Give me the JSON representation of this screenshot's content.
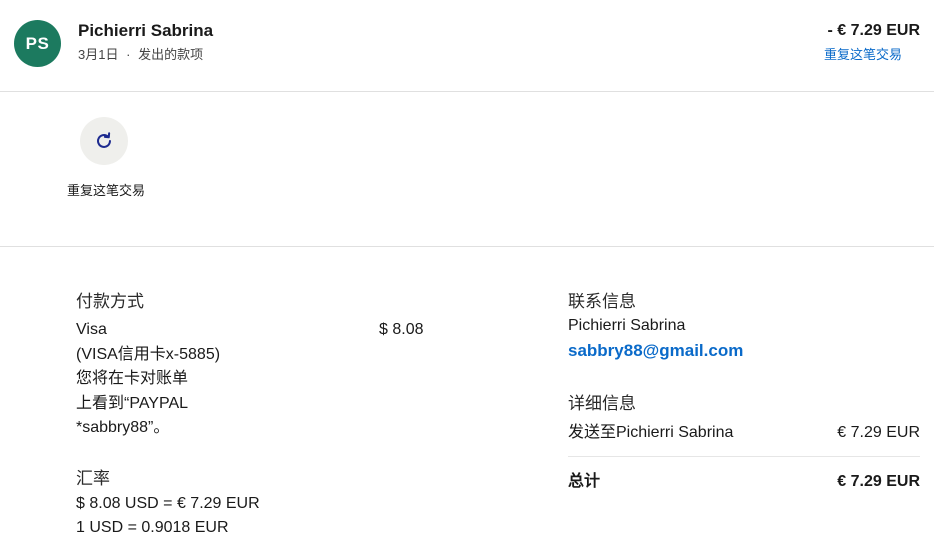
{
  "header": {
    "avatar_initials": "PS",
    "name": "Pichierri Sabrina",
    "date": "3月1日",
    "separator": "·",
    "type": "发出的款项",
    "amount": "- € 7.29 EUR",
    "repeat_link": "重复这笔交易"
  },
  "action": {
    "icon": "refresh-icon",
    "label": "重复这笔交易"
  },
  "payment": {
    "title": "付款方式",
    "method_lines": [
      "Visa",
      "(VISA信用卡x-5885)",
      "您将在卡对账单",
      "上看到“PAYPAL",
      "*sabbry88”。"
    ],
    "amount": "$ 8.08"
  },
  "exchange": {
    "title": "汇率",
    "line1": "$ 8.08 USD = € 7.29 EUR",
    "line2": "1 USD = 0.9018 EUR"
  },
  "contact": {
    "title": "联系信息",
    "name": "Pichierri Sabrina",
    "email": "sabbry88@gmail.com"
  },
  "details": {
    "title": "详细信息",
    "sent_to_label": "发送至Pichierri Sabrina",
    "sent_to_amount": "€ 7.29 EUR",
    "total_label": "总计",
    "total_amount": "€ 7.29 EUR"
  },
  "colors": {
    "avatar": "#1c7a5f",
    "link": "#0a6ac9",
    "action_bg": "#efefec",
    "icon": "#1d2a8f"
  }
}
